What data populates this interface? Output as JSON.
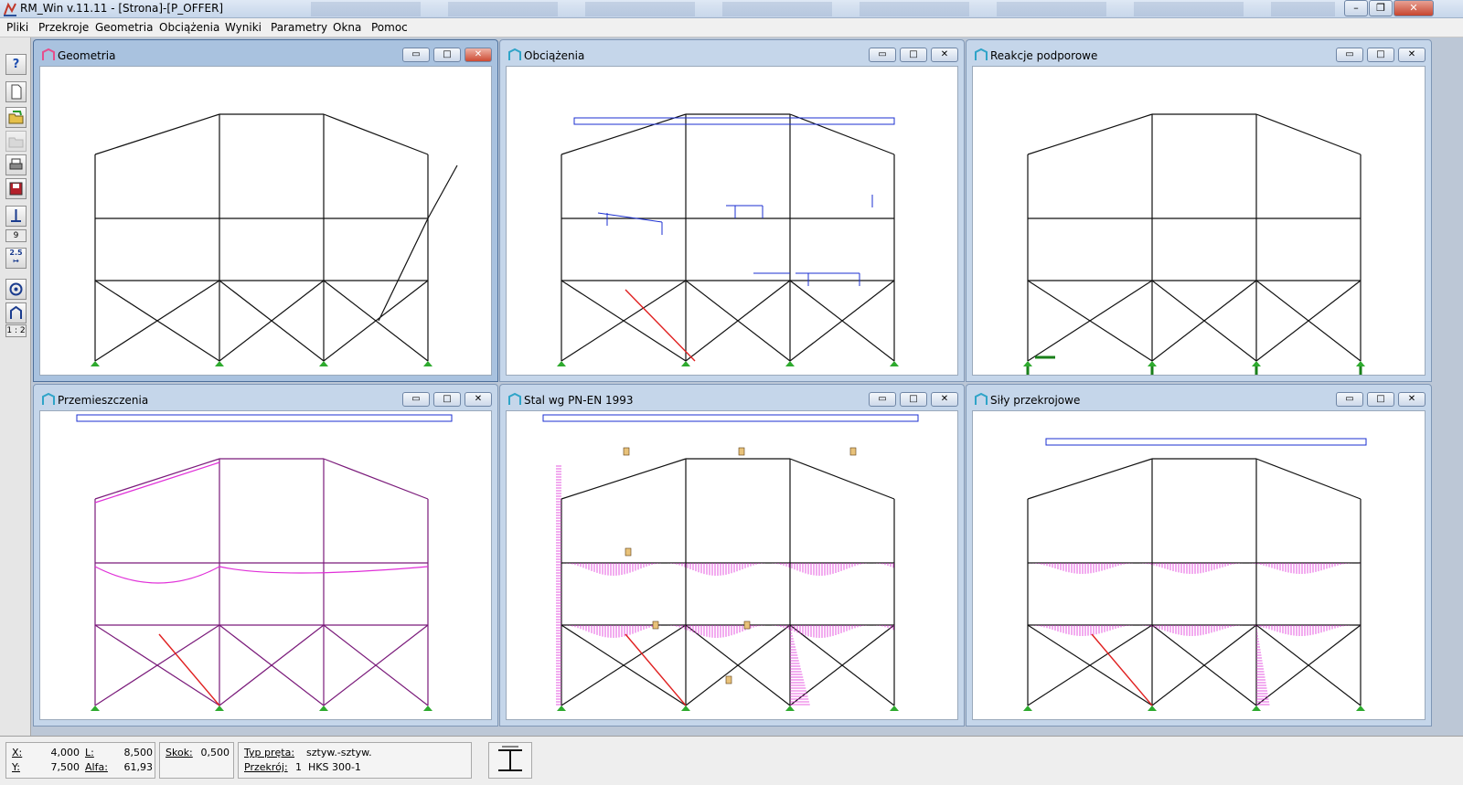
{
  "app": {
    "title": "RM_Win v.11.11 - [Strona]-[P_OFFER]"
  },
  "menu": [
    "Pliki",
    "Przekroje",
    "Geometria",
    "Obciążenia",
    "Wyniki",
    "Parametry",
    "Okna",
    "Pomoc"
  ],
  "toolbar": {
    "label_9": "9",
    "label_25": "2.5",
    "label_scale": "1 : 2"
  },
  "windows": [
    {
      "title": "Geometria"
    },
    {
      "title": "Obciążenia"
    },
    {
      "title": "Reakcje podporowe"
    },
    {
      "title": "Przemieszczenia"
    },
    {
      "title": "Stal wg PN-EN 1993"
    },
    {
      "title": "Siły przekrojowe"
    }
  ],
  "status": {
    "x_label": "X:",
    "x_value": "4,000",
    "y_label": "Y:",
    "y_value": "7,500",
    "l_label": "L:",
    "l_value": "8,500",
    "alfa_label": "Alfa:",
    "alfa_value": "61,93",
    "skok_label": "Skok:",
    "skok_value": "0,500",
    "typ_label": "Typ pręta:",
    "typ_value": "sztyw.-sztyw.",
    "przekroj_label": "Przekrój:",
    "przekroj_num": "1",
    "przekroj_value": "HKS 300-1"
  }
}
